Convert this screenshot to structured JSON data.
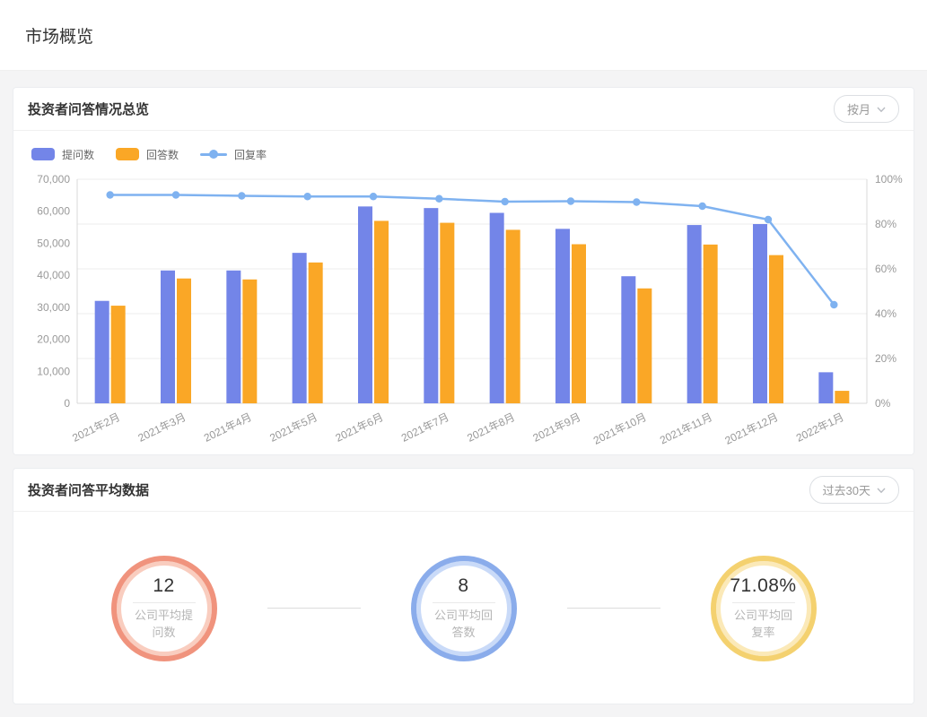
{
  "page": {
    "title": "市场概览"
  },
  "overview_card": {
    "title": "投资者问答情况总览",
    "period_selector": {
      "value": "按月"
    },
    "legend": [
      {
        "label": "提问数",
        "type": "bar",
        "color": "#7385E8"
      },
      {
        "label": "回答数",
        "type": "bar",
        "color": "#FAA726"
      },
      {
        "label": "回复率",
        "type": "line",
        "color": "#7FB2F0"
      }
    ],
    "chart_data": {
      "type": "bar",
      "title": "投资者问答情况总览",
      "categories": [
        "2021年2月",
        "2021年3月",
        "2021年4月",
        "2021年5月",
        "2021年6月",
        "2021年7月",
        "2021年8月",
        "2021年9月",
        "2021年10月",
        "2021年11月",
        "2021年12月",
        "2022年1月"
      ],
      "series": [
        {
          "name": "提问数",
          "type": "bar",
          "axis": "left",
          "color": "#7385E8",
          "values": [
            32000,
            41500,
            41500,
            47000,
            61500,
            61000,
            59500,
            54500,
            39700,
            55700,
            56000,
            9700
          ]
        },
        {
          "name": "回答数",
          "type": "bar",
          "axis": "left",
          "color": "#FAA726",
          "values": [
            30500,
            39000,
            38700,
            44000,
            57000,
            56400,
            54200,
            49700,
            35900,
            49600,
            46300,
            3900
          ]
        },
        {
          "name": "回复率",
          "type": "line",
          "axis": "right",
          "color": "#7FB2F0",
          "values": [
            93,
            93,
            92.6,
            92.3,
            92.3,
            91.3,
            90,
            90.2,
            89.8,
            88,
            82,
            44
          ]
        }
      ],
      "left_axis": {
        "min": 0,
        "max": 70000,
        "step": 10000,
        "tick_labels": [
          "0",
          "10,000",
          "20,000",
          "30,000",
          "40,000",
          "50,000",
          "60,000",
          "70,000"
        ]
      },
      "right_axis": {
        "min": 0,
        "max": 100,
        "step": 20,
        "tick_labels": [
          "0%",
          "20%",
          "40%",
          "60%",
          "80%",
          "100%"
        ]
      },
      "grid": "horizontal gridlines aligned to right-axis 20% steps",
      "legend_position": "top-left",
      "x_label_rotation": -26
    }
  },
  "average_card": {
    "title": "投资者问答平均数据",
    "range_selector": {
      "value": "过去30天"
    },
    "stats": [
      {
        "value": "12",
        "label": "公司平均提问数",
        "ring_color": "#F0937D",
        "ring_inner_color": "#F9CDBF"
      },
      {
        "value": "8",
        "label": "公司平均回答数",
        "ring_color": "#8AACEB",
        "ring_inner_color": "#C9DAF8"
      },
      {
        "value": "71.08%",
        "label": "公司平均回复率",
        "ring_color": "#F4D16F",
        "ring_inner_color": "#FBE9B8"
      }
    ]
  },
  "colors": {
    "page_background": "#f4f4f5",
    "card_background": "#ffffff",
    "axis_label": "#999999",
    "gridline": "#ececec",
    "axis_line": "#d9d9d9"
  }
}
